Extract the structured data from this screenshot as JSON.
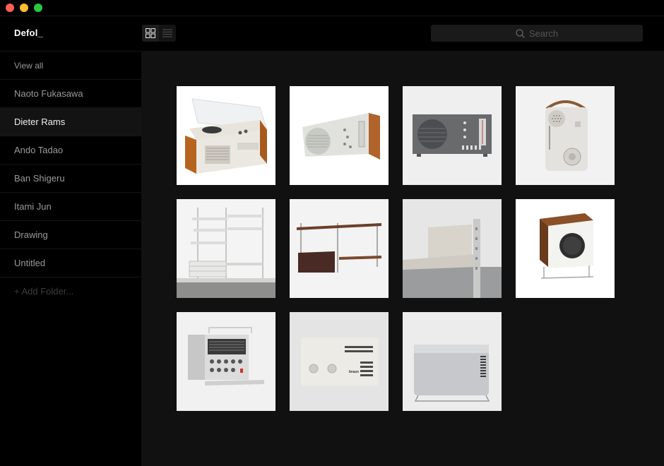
{
  "window": {
    "title": "Defol_"
  },
  "toolbar": {
    "grid_view_icon": "grid-icon",
    "list_view_icon": "list-icon",
    "search_placeholder": "Search",
    "search_icon": "search-icon"
  },
  "sidebar": {
    "items": [
      {
        "label": "View all"
      },
      {
        "label": "Naoto Fukasawa"
      },
      {
        "label": "Dieter Rams",
        "selected": true
      },
      {
        "label": "Ando Tadao"
      },
      {
        "label": "Ban Shigeru"
      },
      {
        "label": "Itami Jun"
      },
      {
        "label": "Drawing"
      },
      {
        "label": "Untitled"
      }
    ],
    "add_folder_label": "+ Add Folder..."
  },
  "gallery": {
    "items": [
      {
        "subject": "record-player",
        "background": "#ffffff"
      },
      {
        "subject": "radio-wood",
        "background": "#ffffff"
      },
      {
        "subject": "radio-grey",
        "background": "#efefef"
      },
      {
        "subject": "portable-radio",
        "background": "#f2f2f2"
      },
      {
        "subject": "shelf-system",
        "background": "#f4f4f4"
      },
      {
        "subject": "wall-shelf",
        "background": "#f3f3f3"
      },
      {
        "subject": "shelf-bracket",
        "background": "#e6e6e6"
      },
      {
        "subject": "speaker-box",
        "background": "#ffffff"
      },
      {
        "subject": "world-receiver",
        "background": "#f1f1f1"
      },
      {
        "subject": "braun-radio",
        "background": "#e4e4e4"
      },
      {
        "subject": "heater",
        "background": "#ececec"
      }
    ],
    "thumb_text": {
      "braun_radio_brand": "braun"
    }
  },
  "colors": {
    "close": "#fe5f57",
    "minimize": "#febc2e",
    "maximize": "#28c840",
    "sidebar_bg": "#000000",
    "main_bg": "#111111",
    "selected_bg": "#131313"
  }
}
